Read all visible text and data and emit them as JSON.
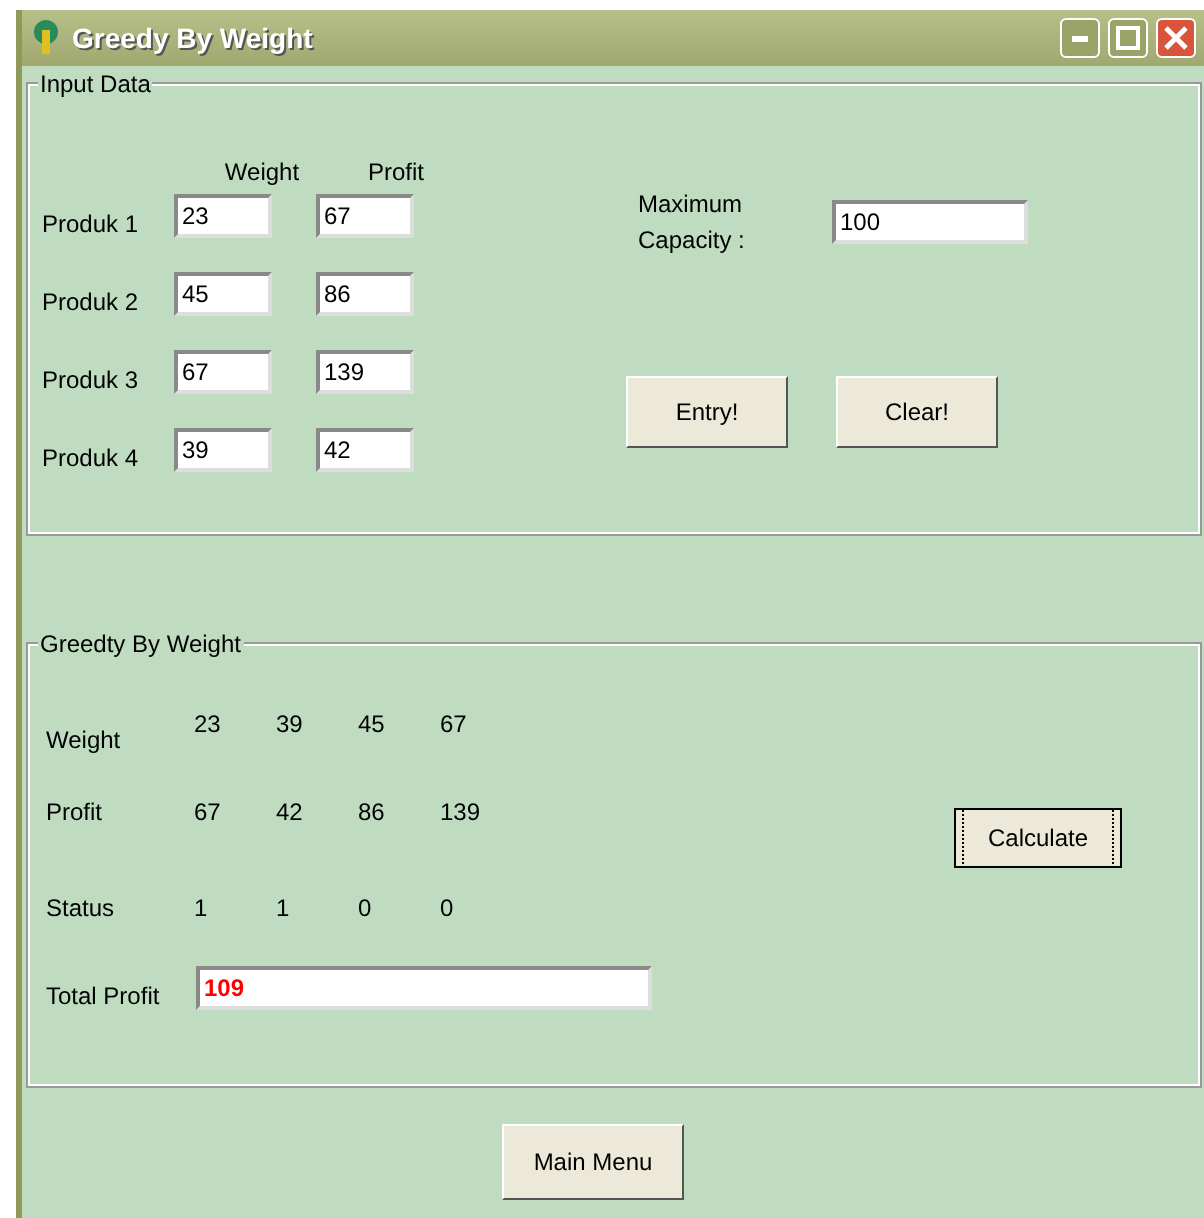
{
  "window": {
    "title": "Greedy By Weight"
  },
  "input_frame": {
    "title": "Input Data",
    "column_headers": [
      "Weight",
      "Profit"
    ],
    "products": [
      {
        "label": "Produk 1",
        "weight": "23",
        "profit": "67"
      },
      {
        "label": "Produk 2",
        "weight": "45",
        "profit": "86"
      },
      {
        "label": "Produk 3",
        "weight": "67",
        "profit": "139"
      },
      {
        "label": "Produk 4",
        "weight": "39",
        "profit": "42"
      }
    ],
    "capacity_label": "Maximum Capacity :",
    "capacity_value": "100",
    "buttons": [
      "Entry!",
      "Clear!"
    ]
  },
  "result_frame": {
    "title": "Greedty By Weight",
    "rows": [
      {
        "label": "Weight",
        "values": [
          "23",
          "39",
          "45",
          "67"
        ]
      },
      {
        "label": "Profit",
        "values": [
          "67",
          "42",
          "86",
          "139"
        ]
      },
      {
        "label": "Status",
        "values": [
          "1",
          "1",
          "0",
          "0"
        ]
      }
    ],
    "calculate_button": {
      "label": "Calculate",
      "focused": true
    },
    "total_label": "Total Profit",
    "total_value": "109"
  },
  "main_menu_button": "Main Menu"
}
